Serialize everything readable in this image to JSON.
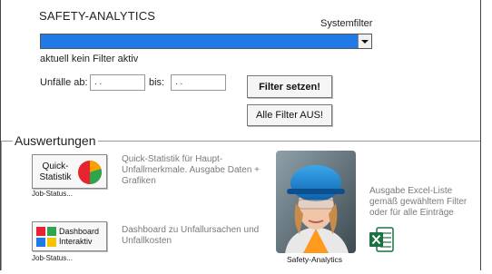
{
  "app": {
    "title": "SAFETY-ANALYTICS"
  },
  "filter": {
    "systemfilter_label": "Systemfilter",
    "status_text": "aktuell kein Filter aktiv",
    "from_label": "Unfälle ab:",
    "from_value": ". .",
    "to_label": "bis:",
    "to_value": ". .",
    "set_button": "Filter setzen!",
    "clear_button": "Alle Filter AUS!"
  },
  "section": {
    "title": "Auswertungen",
    "quick": {
      "label_line1": "Quick-",
      "label_line2": "Statistik",
      "job_status": "Job-Status...",
      "description": "Quick-Statistik für Haupt-Unfallmerkmale. Ausgabe Daten + Grafiken"
    },
    "dashboard": {
      "label_line1": "Dashboard",
      "label_line2": "Interaktiv",
      "job_status": "Job-Status...",
      "description": "Dashboard zu Unfallursachen und Unfallkosten"
    },
    "photo_caption": "Safety-Analytics",
    "excel_description": "Ausgabe Excel-Liste gemäß gewähltem Filter oder für alle Einträge"
  },
  "colors": {
    "dropdown_fill": "#1f7ae6",
    "description_text": "#7a7a7a"
  },
  "icons": {
    "quick": "pie-chart-icon",
    "dashboard": "dashboard-tiles-icon",
    "excel": "excel-icon",
    "dropdown": "chevron-down-icon"
  }
}
